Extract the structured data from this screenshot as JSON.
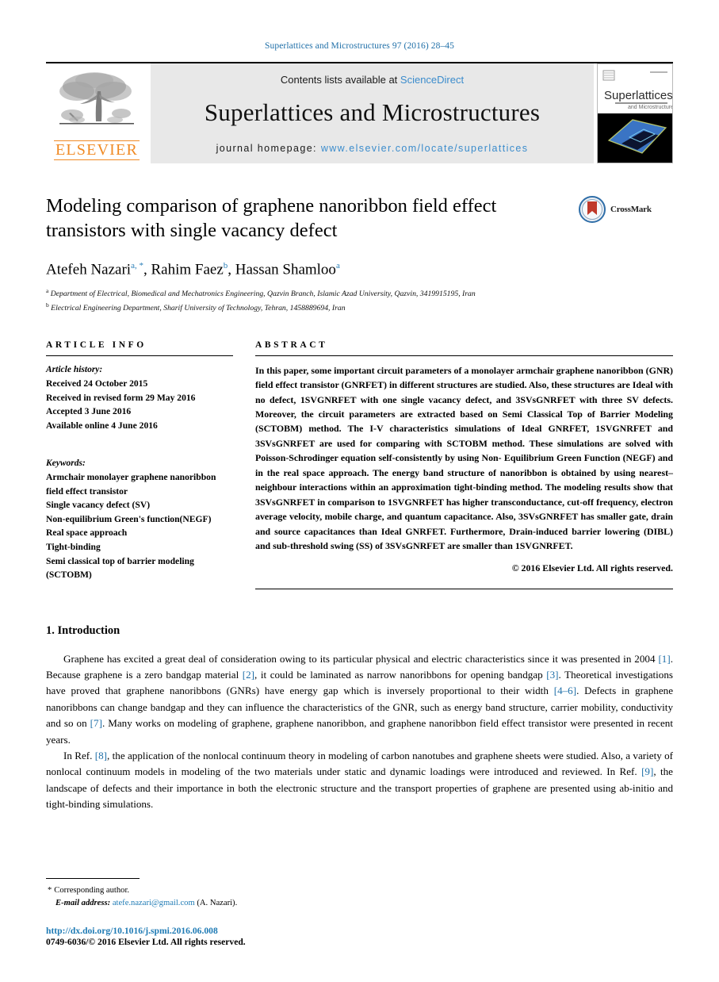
{
  "running_head": "Superlattices and Microstructures 97 (2016) 28–45",
  "masthead": {
    "publisher_logo_label": "ELSEVIER",
    "contents_prefix": "Contents lists available at ",
    "contents_link": "ScienceDirect",
    "journal_title": "Superlattices and Microstructures",
    "homepage_prefix": "journal homepage: ",
    "homepage_url": "www.elsevier.com/locate/superlattices",
    "cover": {
      "title_main": "Superlattices",
      "title_sub": "and Microstructures"
    }
  },
  "article": {
    "title": "Modeling comparison of graphene nanoribbon field effect transistors with single vacancy defect",
    "crossmark_label": "CrossMark",
    "authors": [
      {
        "name": "Atefeh Nazari",
        "marks": "a, *"
      },
      {
        "name": "Rahim Faez",
        "marks": "b"
      },
      {
        "name": "Hassan Shamloo",
        "marks": "a"
      }
    ],
    "affiliations": [
      {
        "mark": "a",
        "text": "Department of Electrical, Biomedical and Mechatronics Engineering, Qazvin Branch, Islamic Azad University, Qazvin, 3419915195, Iran"
      },
      {
        "mark": "b",
        "text": "Electrical Engineering Department, Sharif University of Technology, Tehran, 1458889694, Iran"
      }
    ]
  },
  "article_info": {
    "heading": "ARTICLE INFO",
    "history_label": "Article history:",
    "history": [
      "Received 24 October 2015",
      "Received in revised form 29 May 2016",
      "Accepted 3 June 2016",
      "Available online 4 June 2016"
    ],
    "keywords_label": "Keywords:",
    "keywords": [
      "Armchair monolayer graphene nanoribbon field effect transistor",
      "Single vacancy defect (SV)",
      "Non-equilibrium Green's function(NEGF)",
      "Real space approach",
      "Tight-binding",
      "Semi classical top of barrier modeling (SCTOBM)"
    ]
  },
  "abstract": {
    "heading": "ABSTRACT",
    "text": "In this paper, some important circuit parameters of a monolayer armchair graphene nanoribbon (GNR) field effect transistor (GNRFET) in different structures are studied. Also, these structures are Ideal with no defect, 1SVGNRFET with one single vacancy defect, and 3SVsGNRFET with three SV defects. Moreover, the circuit parameters are extracted based on Semi Classical Top of Barrier Modeling (SCTOBM) method. The I-V characteristics simulations of Ideal GNRFET, 1SVGNRFET and 3SVsGNRFET are used for comparing with SCTOBM method. These simulations are solved with Poisson-Schrodinger equation self-consistently by using Non- Equilibrium Green Function (NEGF) and in the real space approach. The energy band structure of nanoribbon is obtained by using nearest–neighbour interactions within an approximation tight-binding method. The modeling results show that 3SVsGNRFET in comparison to 1SVGNRFET has higher transconductance, cut-off frequency, electron average velocity, mobile charge, and quantum capacitance. Also, 3SVsGNRFET has smaller gate, drain and source capacitances than Ideal GNRFET. Furthermore, Drain-induced barrier lowering (DIBL) and sub-threshold swing (SS) of 3SVsGNRFET are smaller than 1SVGNRFET.",
    "copyright": "© 2016 Elsevier Ltd. All rights reserved."
  },
  "introduction": {
    "section_title": "1. Introduction",
    "paragraph1": {
      "p1": "Graphene has excited a great deal of consideration owing to its particular physical and electric characteristics since it was presented in 2004 ",
      "r1": "[1]",
      "p2": ". Because graphene is a zero bandgap material ",
      "r2": "[2]",
      "p3": ", it could be laminated as narrow nanoribbons for opening bandgap ",
      "r3": "[3]",
      "p4": ". Theoretical investigations have proved that graphene nanoribbons (GNRs) have energy gap which is inversely proportional to their width ",
      "r4": "[4–6]",
      "p5": ". Defects in graphene nanoribbons can change bandgap and they can influence the characteristics of the GNR, such as energy band structure, carrier mobility, conductivity and so on ",
      "r5": "[7]",
      "p6": ". Many works on modeling of graphene, graphene nanoribbon, and graphene nanoribbon field effect transistor were presented in recent years."
    },
    "paragraph2": {
      "p1": "In Ref. ",
      "r1": "[8]",
      "p2": ", the application of the nonlocal continuum theory in modeling of carbon nanotubes and graphene sheets were studied. Also, a variety of nonlocal continuum models in modeling of the two materials under static and dynamic loadings were introduced and reviewed. In Ref. ",
      "r2": "[9]",
      "p3": ", the landscape of defects and their importance in both the electronic structure and the transport properties of graphene are presented using ab-initio and tight-binding simulations."
    }
  },
  "footer": {
    "corresponding_star": "*",
    "corresponding_label": "Corresponding author.",
    "email_label": "E-mail address:",
    "email": "atefe.nazari@gmail.com",
    "email_suffix": "(A. Nazari).",
    "doi": "http://dx.doi.org/10.1016/j.spmi.2016.06.008",
    "issn_line": "0749-6036/© 2016 Elsevier Ltd. All rights reserved."
  },
  "colors": {
    "link_blue": "#1f6fa8",
    "sciencedirect_blue": "#3b8ccc",
    "elsevier_orange": "#f08a24",
    "band_gray": "#e8e8e8"
  }
}
